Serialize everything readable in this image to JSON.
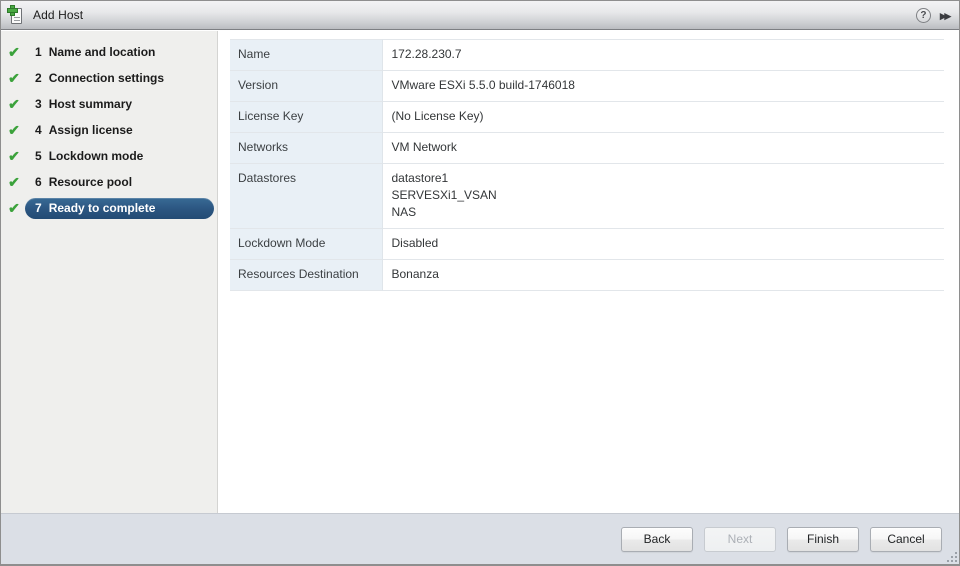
{
  "window": {
    "title": "Add Host",
    "icon": "add-host-icon",
    "help_label": "?",
    "expand_label": "▸▸"
  },
  "sidebar": {
    "steps": [
      {
        "number": "1",
        "label": "Name and location",
        "completed": true,
        "active": false
      },
      {
        "number": "2",
        "label": "Connection settings",
        "completed": true,
        "active": false
      },
      {
        "number": "3",
        "label": "Host summary",
        "completed": true,
        "active": false
      },
      {
        "number": "4",
        "label": "Assign license",
        "completed": true,
        "active": false
      },
      {
        "number": "5",
        "label": "Lockdown mode",
        "completed": true,
        "active": false
      },
      {
        "number": "6",
        "label": "Resource pool",
        "completed": true,
        "active": false
      },
      {
        "number": "7",
        "label": "Ready to complete",
        "completed": true,
        "active": true
      }
    ],
    "check_glyph": "✔"
  },
  "summary": {
    "rows": [
      {
        "label": "Name",
        "values": [
          "172.28.230.7"
        ]
      },
      {
        "label": "Version",
        "values": [
          "VMware ESXi 5.5.0 build-1746018"
        ]
      },
      {
        "label": "License Key",
        "values": [
          "(No License Key)"
        ]
      },
      {
        "label": "Networks",
        "values": [
          "VM Network"
        ]
      },
      {
        "label": "Datastores",
        "values": [
          "datastore1",
          "SERVESXi1_VSAN",
          "NAS"
        ]
      },
      {
        "label": "Lockdown Mode",
        "values": [
          "Disabled"
        ]
      },
      {
        "label": "Resources Destination",
        "values": [
          "Bonanza"
        ]
      }
    ]
  },
  "footer": {
    "buttons": [
      {
        "label": "Back",
        "disabled": false,
        "name": "back-button"
      },
      {
        "label": "Next",
        "disabled": true,
        "name": "next-button"
      },
      {
        "label": "Finish",
        "disabled": false,
        "name": "finish-button"
      },
      {
        "label": "Cancel",
        "disabled": false,
        "name": "cancel-button"
      }
    ]
  },
  "colors": {
    "accent_selected": "#2b5580",
    "check_green": "#3ba23b",
    "label_cell_bg": "#e9f0f6",
    "sidebar_bg": "#efefed",
    "footer_bg": "#dbdfe6"
  }
}
